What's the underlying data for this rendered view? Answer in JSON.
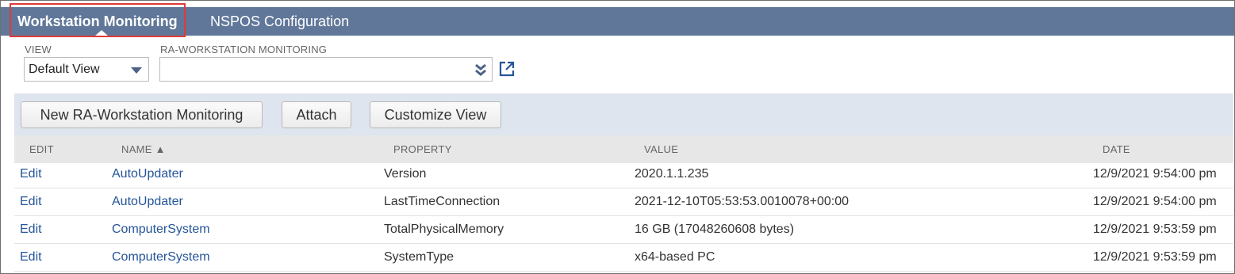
{
  "tabs": [
    {
      "label": "Workstation Monitoring",
      "active": true
    },
    {
      "label": "NSPOS Configuration",
      "active": false
    }
  ],
  "filters": {
    "view_label": "VIEW",
    "view_value": "Default View",
    "ra_label": "RA-WORKSTATION MONITORING",
    "ra_value": ""
  },
  "buttons": {
    "new_record": "New RA-Workstation Monitoring",
    "attach": "Attach",
    "customize_view": "Customize View"
  },
  "table": {
    "columns": [
      "EDIT",
      "NAME ▲",
      "PROPERTY",
      "VALUE",
      "DATE"
    ],
    "rows": [
      {
        "edit": "Edit",
        "name": "AutoUpdater",
        "property": "Version",
        "value": "2020.1.1.235",
        "date": "12/9/2021 9:54:00 pm"
      },
      {
        "edit": "Edit",
        "name": "AutoUpdater",
        "property": "LastTimeConnection",
        "value": "2021-12-10T05:53:53.0010078+00:00",
        "date": "12/9/2021 9:54:00 pm"
      },
      {
        "edit": "Edit",
        "name": "ComputerSystem",
        "property": "TotalPhysicalMemory",
        "value": "16 GB (17048260608 bytes)",
        "date": "12/9/2021 9:53:59 pm"
      },
      {
        "edit": "Edit",
        "name": "ComputerSystem",
        "property": "SystemType",
        "value": "x64-based PC",
        "date": "12/9/2021 9:53:59 pm"
      }
    ]
  },
  "colors": {
    "tab_bar": "#607799",
    "link": "#255599",
    "highlight": "#e03a3a",
    "button_bar": "#dfe5ee"
  },
  "icons": [
    "dropdown-caret-icon",
    "double-chevron-down-icon",
    "open-external-icon"
  ]
}
